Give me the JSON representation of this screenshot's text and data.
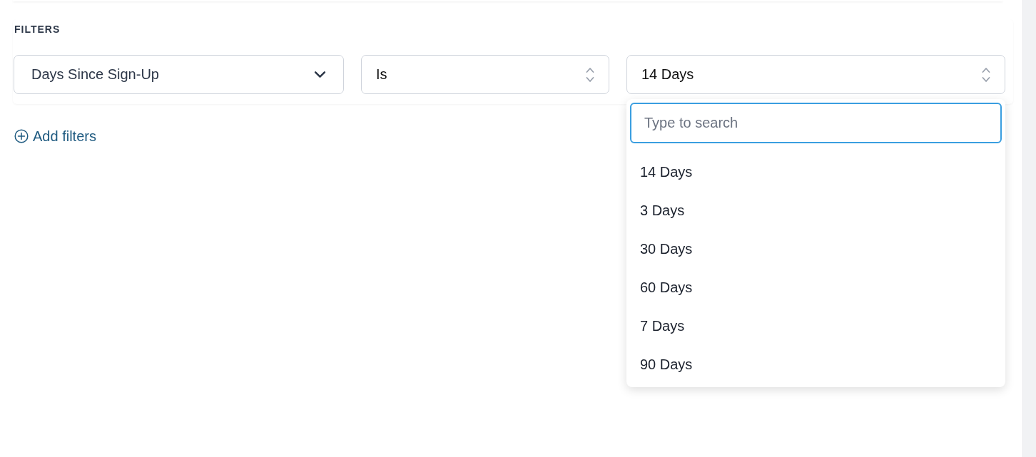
{
  "section": {
    "title": "FILTERS"
  },
  "filters": [
    {
      "kind": "dropdown",
      "value": "Days Since Sign-Up"
    },
    {
      "kind": "select",
      "value": "Is"
    },
    {
      "kind": "select",
      "value": "14 Days",
      "menu": {
        "search": {
          "placeholder": "Type to search",
          "focused": true
        },
        "options": [
          {
            "label": "14 Days"
          },
          {
            "label": "3 Days"
          },
          {
            "label": "30 Days"
          },
          {
            "label": "60 Days"
          },
          {
            "label": "7 Days"
          },
          {
            "label": "90 Days"
          }
        ]
      }
    }
  ],
  "add_filter": {
    "label": "Add filters"
  }
}
